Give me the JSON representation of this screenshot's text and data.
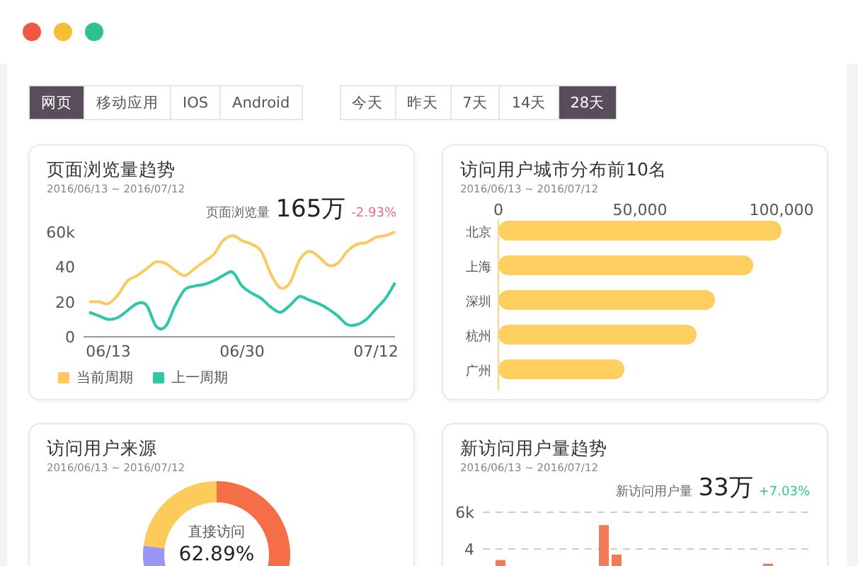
{
  "window": {
    "controls": [
      {
        "color": "#f0573f"
      },
      {
        "color": "#f7bd33"
      },
      {
        "color": "#2cc48b"
      }
    ]
  },
  "platform_tabs": [
    {
      "label": "网页",
      "selected": true
    },
    {
      "label": "移动应用",
      "selected": false
    },
    {
      "label": "IOS",
      "selected": false
    },
    {
      "label": "Android",
      "selected": false
    }
  ],
  "range_tabs": [
    {
      "label": "今天",
      "selected": false
    },
    {
      "label": "昨天",
      "selected": false
    },
    {
      "label": "7天",
      "selected": false
    },
    {
      "label": "14天",
      "selected": false
    },
    {
      "label": "28天",
      "selected": true
    }
  ],
  "cards": [
    {
      "kind": "chart",
      "title": "页面浏览量趋势",
      "date_range": "2016/06/13 ~ 2016/07/12",
      "metric": {
        "label": "页面浏览量",
        "value": "165万",
        "change": "-2.93%",
        "color": "#e5708f"
      },
      "chart_data": {
        "type": "line",
        "categories": [
          null,
          null,
          "06/13",
          null,
          null,
          null,
          null,
          null,
          null,
          null,
          null,
          null,
          null,
          null,
          null,
          null,
          "06/30",
          null,
          null,
          null,
          null,
          null,
          null,
          null,
          null,
          null,
          null,
          null,
          null,
          null,
          "07/12",
          null,
          null
        ],
        "ylim": [
          0,
          60
        ],
        "yticks": [
          0,
          20,
          40,
          {
            "value": 60,
            "label": "60k"
          }
        ],
        "series": [
          {
            "name": "当前周期",
            "color": "#fbc95e",
            "values": [
              20,
              20,
              19,
              24,
              32,
              35,
              39,
              43,
              42,
              38,
              35,
              39,
              43,
              47,
              55,
              58,
              55,
              53,
              49,
              36,
              28,
              31,
              44,
              49,
              46,
              41,
              42,
              49,
              53,
              54,
              57,
              58,
              60
            ]
          },
          {
            "name": "上一周期",
            "color": "#2ec6a8",
            "values": [
              14,
              12,
              10,
              11,
              15,
              19,
              18,
              6,
              6,
              18,
              27,
              29,
              30,
              32,
              35,
              37,
              29,
              25,
              22,
              17,
              14,
              18,
              23,
              21,
              19,
              16,
              12,
              7,
              7,
              10,
              16,
              22,
              31
            ]
          }
        ]
      }
    },
    {
      "kind": "chart",
      "title": "访问用户城市分布前10名",
      "date_range": "2016/06/13 ~ 2016/07/12",
      "chart_data": {
        "type": "bar",
        "orientation": "horizontal",
        "categories": [
          "北京",
          "上海",
          "深圳",
          "杭州",
          "广州"
        ],
        "xlim": [
          0,
          100000
        ],
        "xticks": [
          0,
          {
            "value": 50000,
            "label": "50,000"
          },
          {
            "value": 100000,
            "label": "100,000"
          }
        ],
        "series": [
          {
            "color": "#fdcf5f",
            "values": [
              100000,
              90000,
              76500,
              70000,
              44500
            ]
          }
        ]
      }
    },
    {
      "kind": "donut",
      "title": "访问用户来源",
      "date_range": "2016/06/13 ~ 2016/07/12",
      "center_label": "直接访问",
      "center_value": "62.89%",
      "segments": [
        {
          "color": "#f56e46"
        },
        {
          "color": "#9b94f2"
        },
        {
          "color": "#fccb5a"
        }
      ]
    },
    {
      "kind": "vbar",
      "title": "新访问用户量趋势",
      "date_range": "2016/06/13 ~ 2016/07/12",
      "metric": {
        "label": "新访问用户量",
        "value": "33万",
        "change": "+7.03%",
        "color": "#35c38f"
      },
      "axis_labels": [
        "6k",
        "4"
      ]
    }
  ]
}
